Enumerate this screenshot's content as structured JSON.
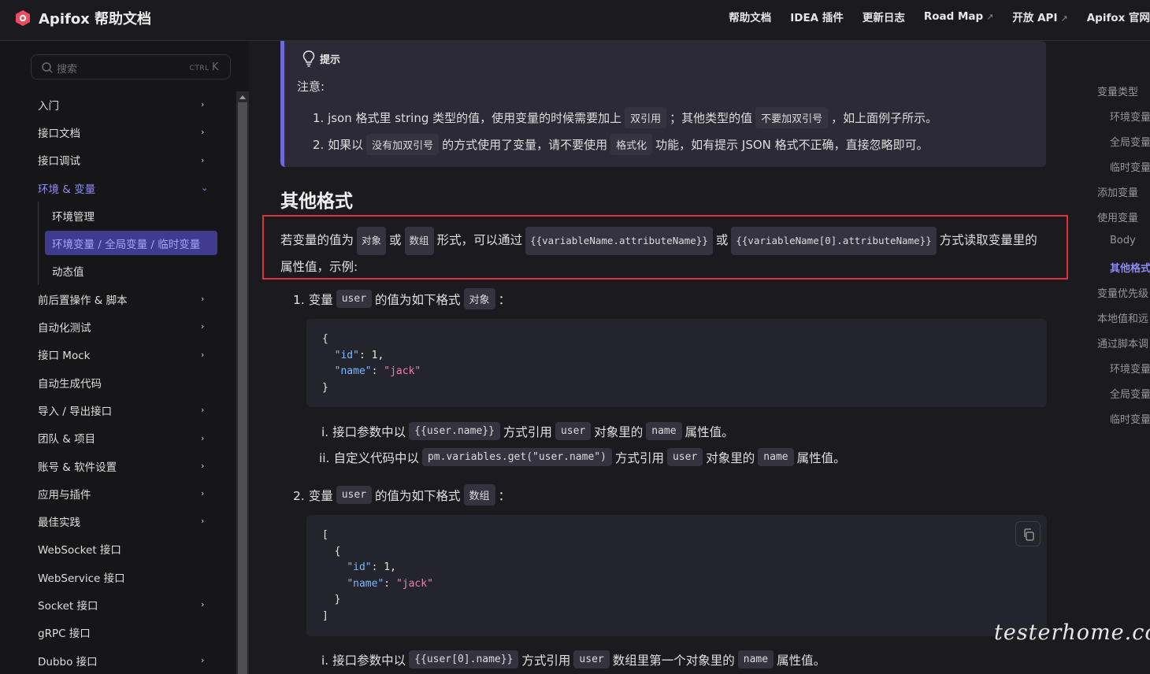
{
  "header": {
    "brand": "Apifox 帮助文档",
    "nav": [
      {
        "label": "帮助文档"
      },
      {
        "label": "IDEA 插件"
      },
      {
        "label": "更新日志"
      },
      {
        "label": "Road Map",
        "arrow": "↗"
      },
      {
        "label": "开放 API",
        "arrow": "↗"
      },
      {
        "label": "Apifox 官网"
      }
    ]
  },
  "sidebar": {
    "search_placeholder": "搜索",
    "search_kbd_ctrl": "CTRL",
    "search_kbd_key": "K",
    "items": [
      {
        "label": "入门",
        "chevron": "›"
      },
      {
        "label": "接口文档",
        "chevron": "›"
      },
      {
        "label": "接口调试",
        "chevron": "›"
      },
      {
        "label": "环境 & 变量",
        "chevron": "⌄"
      },
      {
        "label": "前后置操作 & 脚本",
        "chevron": "›"
      },
      {
        "label": "自动化测试",
        "chevron": "›"
      },
      {
        "label": "接口 Mock",
        "chevron": "›"
      },
      {
        "label": "自动生成代码"
      },
      {
        "label": "导入 / 导出接口",
        "chevron": "›"
      },
      {
        "label": "团队 & 项目",
        "chevron": "›"
      },
      {
        "label": "账号 & 软件设置",
        "chevron": "›"
      },
      {
        "label": "应用与插件",
        "chevron": "›"
      },
      {
        "label": "最佳实践",
        "chevron": "›"
      },
      {
        "label": "WebSocket 接口"
      },
      {
        "label": "WebService 接口"
      },
      {
        "label": "Socket 接口",
        "chevron": "›"
      },
      {
        "label": "gRPC 接口"
      },
      {
        "label": "Dubbo 接口",
        "chevron": "›"
      }
    ],
    "sub_items": [
      {
        "label": "环境管理"
      },
      {
        "label": "环境变量 / 全局变量 / 临时变量"
      },
      {
        "label": "动态值"
      }
    ]
  },
  "tip": {
    "title": "提示",
    "note": "注意:",
    "line1": {
      "a": "1. json 格式里 string 类型的值，使用变量的时候需要加上",
      "c1": "双引用",
      "b": "；其他类型的值",
      "c2": "不要加双引号",
      "c": "，如上面例子所示。"
    },
    "line2": {
      "a": "2. 如果以",
      "c1": "没有加双引号",
      "b": "的方式使用了变量，请不要使用",
      "c2": "格式化",
      "c": "功能，如有提示 JSON 格式不正确，直接忽略即可。"
    }
  },
  "section": {
    "heading": "其他格式",
    "para": {
      "t1": "若变量的值为",
      "c1": "对象",
      "t2": "或",
      "c2": "数组",
      "t3": "形式，可以通过",
      "c3": "{{variableName.attributeName}}",
      "t4": "或",
      "c4": "{{variableName[0].attributeName}}",
      "t5": "方式读取变量里的属性值，示例:"
    },
    "item1": {
      "n": "1. 变量",
      "c1": "user",
      "t": "的值为如下格式",
      "c2": "对象",
      "end": "："
    },
    "code1": [
      "{",
      "\"id\"",
      "1",
      "\"name\"",
      "\"jack\"",
      "}"
    ],
    "sub1": {
      "n": "i. 接口参数中以",
      "c1": "{{user.name}}",
      "t1": "方式引用",
      "c2": "user",
      "t2": "对象里的",
      "c3": "name",
      "t3": "属性值。"
    },
    "sub2": {
      "n": "ii. 自定义代码中以",
      "c1": "pm.variables.get(\"user.name\")",
      "t1": "方式引用",
      "c2": "user",
      "t2": "对象里的",
      "c3": "name",
      "t3": "属性值。"
    },
    "item2": {
      "n": "2. 变量",
      "c1": "user",
      "t": "的值为如下格式",
      "c2": "数组",
      "end": "："
    },
    "code2": [
      "[",
      "{",
      "\"id\"",
      "1",
      "\"name\"",
      "\"jack\"",
      "}",
      "]"
    ],
    "sub3": {
      "n": "i. 接口参数中以",
      "c1": "{{user[0].name}}",
      "t1": "方式引用",
      "c2": "user",
      "t2": "数组里第一个对象里的",
      "c3": "name",
      "t3": "属性值。"
    }
  },
  "toc": [
    {
      "label": "变量类型"
    },
    {
      "label": "环境变量"
    },
    {
      "label": "全局变量"
    },
    {
      "label": "临时变量"
    },
    {
      "label": "添加变量"
    },
    {
      "label": "使用变量"
    },
    {
      "label": "Body"
    },
    {
      "label": "其他格式"
    },
    {
      "label": "变量优先级"
    },
    {
      "label": "本地值和远"
    },
    {
      "label": "通过脚本调"
    },
    {
      "label": "环境变量"
    },
    {
      "label": "全局变量"
    },
    {
      "label": "临时变量"
    }
  ],
  "watermark": "testerhome.com",
  "colors": {
    "accent": "#8f8bf2",
    "highlight_border": "#e0303a",
    "tip_border": "#6e6ad8",
    "json_key": "#79b8ff",
    "json_string": "#e582b5"
  }
}
